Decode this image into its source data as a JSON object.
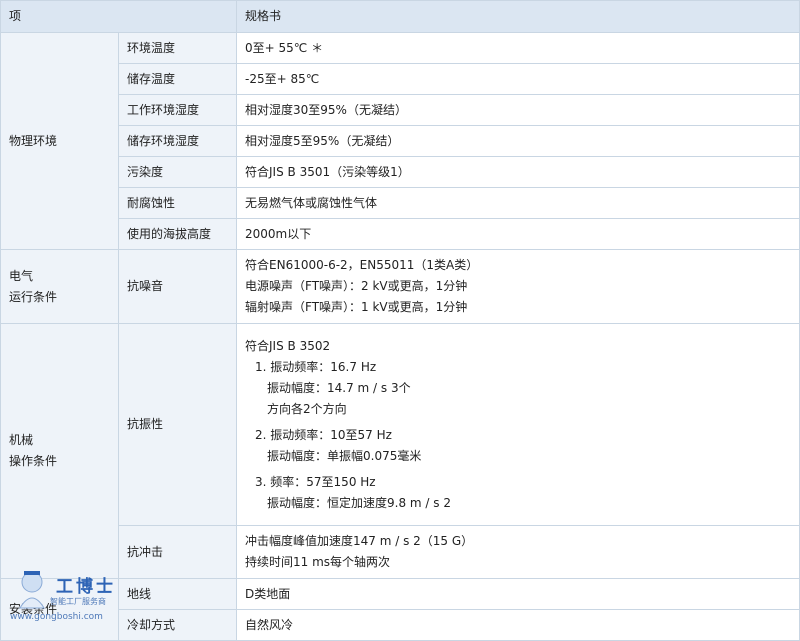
{
  "header": {
    "col_item": "项",
    "col_spec": "规格书"
  },
  "physical": {
    "category": "物理环境",
    "rows": [
      {
        "name": "环境温度",
        "value": "0至+ 55℃ ＊"
      },
      {
        "name": "储存温度",
        "value": "-25至+ 85℃"
      },
      {
        "name": "工作环境湿度",
        "value": "相对湿度30至95%（无凝结）"
      },
      {
        "name": "储存环境湿度",
        "value": "相对湿度5至95%（无凝结）"
      },
      {
        "name": "污染度",
        "value": "符合JIS B 3501（污染等级1）"
      },
      {
        "name": "耐腐蚀性",
        "value": "无易燃气体或腐蚀性气体"
      },
      {
        "name": "使用的海拔高度",
        "value": "2000m以下"
      }
    ]
  },
  "electrical": {
    "category_line1": "电气",
    "category_line2": "运行条件",
    "name": "抗噪音",
    "lines": [
      "符合EN61000-6-2，EN55011（1类A类）",
      "电源噪声（FT噪声）：2 kV或更高，1分钟",
      "辐射噪声（FT噪声）：1 kV或更高，1分钟"
    ]
  },
  "mechanical": {
    "category_line1": "机械",
    "category_line2": "操作条件",
    "vibration": {
      "name": "抗振性",
      "standard": "符合JIS B 3502",
      "item1_freq": "1. 振动频率：16.7 Hz",
      "item1_amp": "振动幅度：14.7 m / s 3个",
      "item1_dir": "方向各2个方向",
      "item2_freq": "2. 振动频率：10至57 Hz",
      "item2_amp": "振动幅度：单振幅0.075毫米",
      "item3_freq": "3. 频率：57至150 Hz",
      "item3_amp": "振动幅度：恒定加速度9.8 m / s 2"
    },
    "shock": {
      "name": "抗冲击",
      "line1": "冲击幅度峰值加速度147 m / s 2（15 G）",
      "line2": "持续时间11 ms每个轴两次"
    }
  },
  "install": {
    "category": "安装条件",
    "rows": [
      {
        "name": "地线",
        "value": "D类地面"
      },
      {
        "name": "冷却方式",
        "value": "自然风冷"
      }
    ]
  },
  "watermark": {
    "brand": "工博士",
    "tagline": "智能工厂服务商",
    "url": "www.gongboshi.com",
    "color": "#2d63b5"
  }
}
